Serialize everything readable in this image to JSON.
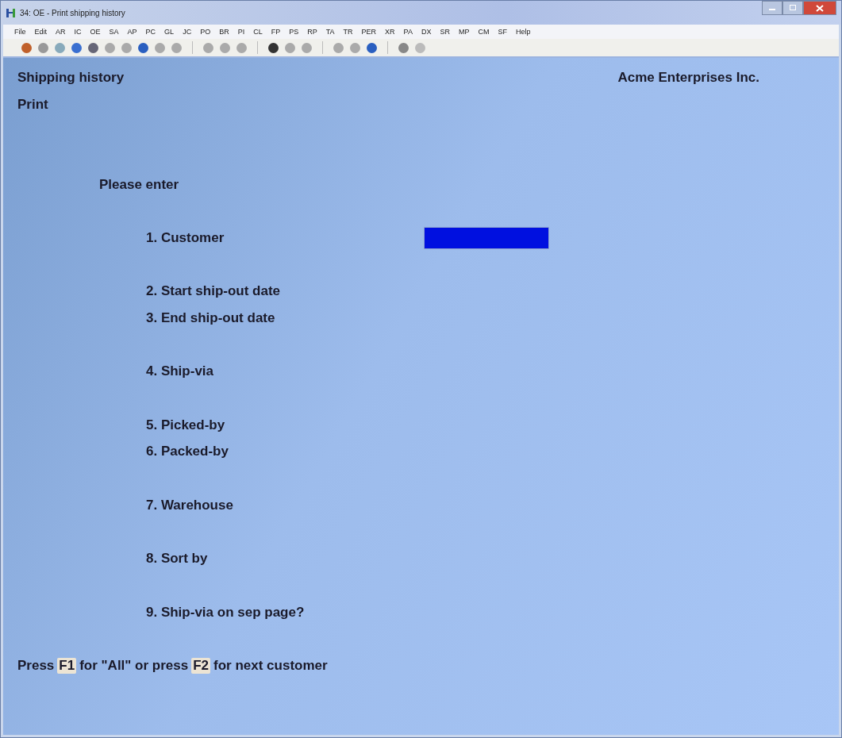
{
  "window": {
    "title": "34: OE - Print shipping history"
  },
  "menu": [
    "File",
    "Edit",
    "AR",
    "IC",
    "OE",
    "SA",
    "AP",
    "PC",
    "GL",
    "JC",
    "PO",
    "BR",
    "PI",
    "CL",
    "FP",
    "PS",
    "RP",
    "TA",
    "TR",
    "PER",
    "XR",
    "PA",
    "DX",
    "SR",
    "MP",
    "CM",
    "SF",
    "Help"
  ],
  "screen": {
    "title": "Shipping history",
    "company": "Acme Enterprises Inc.",
    "mode": "Print",
    "prompt": "Please enter",
    "field_groups": [
      [
        {
          "label": "1. Customer",
          "focused": true
        }
      ],
      [
        {
          "label": "2. Start ship-out date",
          "focused": false
        },
        {
          "label": "3. End ship-out date",
          "focused": false
        }
      ],
      [
        {
          "label": "4. Ship-via",
          "focused": false
        }
      ],
      [
        {
          "label": "5. Picked-by",
          "focused": false
        },
        {
          "label": "6. Packed-by",
          "focused": false
        }
      ],
      [
        {
          "label": "7. Warehouse",
          "focused": false
        }
      ],
      [
        {
          "label": "8. Sort by",
          "focused": false
        }
      ],
      [
        {
          "label": "9. Ship-via on sep page?",
          "focused": false
        }
      ]
    ],
    "hint": [
      {
        "kind": "text",
        "text": "Press"
      },
      {
        "kind": "key",
        "text": "F1"
      },
      {
        "kind": "text",
        "text": "for \"All\" or press"
      },
      {
        "kind": "key",
        "text": "F2"
      },
      {
        "kind": "text",
        "text": "for next customer"
      }
    ]
  }
}
